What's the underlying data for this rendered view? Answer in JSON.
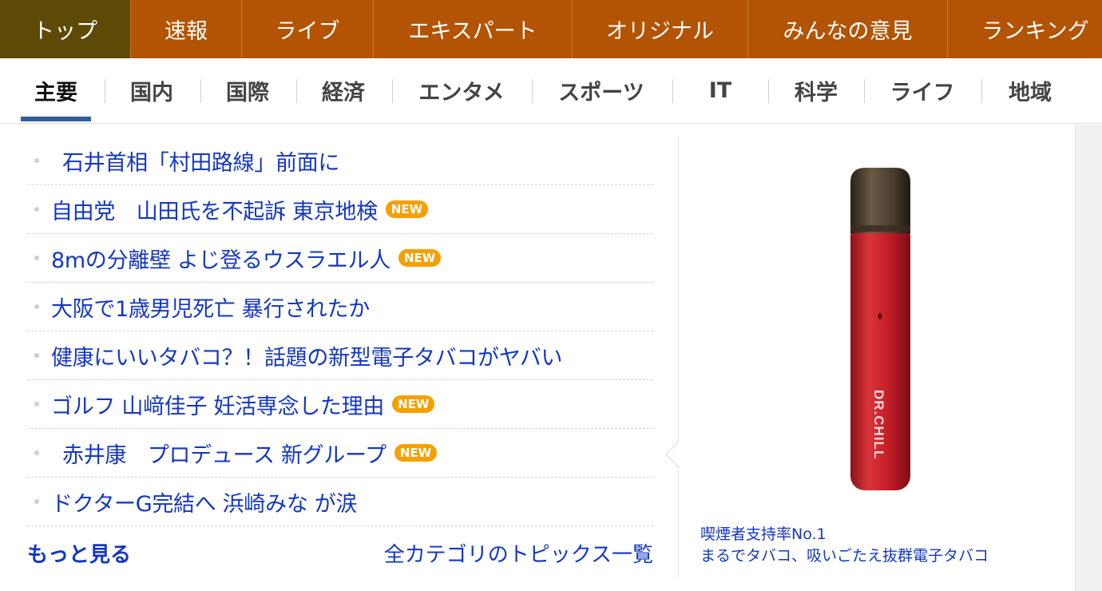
{
  "top_nav": [
    {
      "label": "トップ",
      "active": true
    },
    {
      "label": "速報",
      "active": false
    },
    {
      "label": "ライブ",
      "active": false
    },
    {
      "label": "エキスパート",
      "active": false
    },
    {
      "label": "オリジナル",
      "active": false
    },
    {
      "label": "みんなの意見",
      "active": false
    },
    {
      "label": "ランキング",
      "active": false
    }
  ],
  "category_nav": [
    {
      "label": "主要",
      "active": true
    },
    {
      "label": "国内",
      "active": false
    },
    {
      "label": "国際",
      "active": false
    },
    {
      "label": "経済",
      "active": false
    },
    {
      "label": "エンタメ",
      "active": false
    },
    {
      "label": "スポーツ",
      "active": false
    },
    {
      "label": "IT",
      "active": false
    },
    {
      "label": "科学",
      "active": false
    },
    {
      "label": "ライフ",
      "active": false
    },
    {
      "label": "地域",
      "active": false
    }
  ],
  "news_items": [
    {
      "title": "石井首相「村田路線」前面に",
      "is_new": false
    },
    {
      "title": "自由党　山田氏を不起訴 東京地検",
      "is_new": true
    },
    {
      "title": "8mの分離壁 よじ登るウスラエル人",
      "is_new": true
    },
    {
      "title": "大阪で1歳男児死亡 暴行されたか",
      "is_new": false
    },
    {
      "title": "健康にいいタバコ？！話題の新型電子タバコがヤバい",
      "is_new": false
    },
    {
      "title": "ゴルフ 山﨑佳子 妊活専念した理由",
      "is_new": true
    },
    {
      "title": "赤井康　プロデュース 新グループ",
      "is_new": true
    },
    {
      "title": "ドクターG完結へ 浜崎みな が涙",
      "is_new": false
    }
  ],
  "new_badge_label": "NEW",
  "footer": {
    "more_label": "もっと見る",
    "all_topics_label": "全カテゴリのトピックス一覧"
  },
  "ad": {
    "product_text": "DR.CHILL",
    "caption_line1": "喫煙者支持率No.1",
    "caption_line2": "まるでタバコ、吸いごたえ抜群電子タバコ"
  },
  "colors": {
    "top_nav_bg": "#b25403",
    "top_nav_active_bg": "#5d4a06",
    "link_blue": "#1336c4",
    "new_badge": "#f5a000",
    "active_underline": "#2f5f9a",
    "product_red": "#c8202a"
  }
}
